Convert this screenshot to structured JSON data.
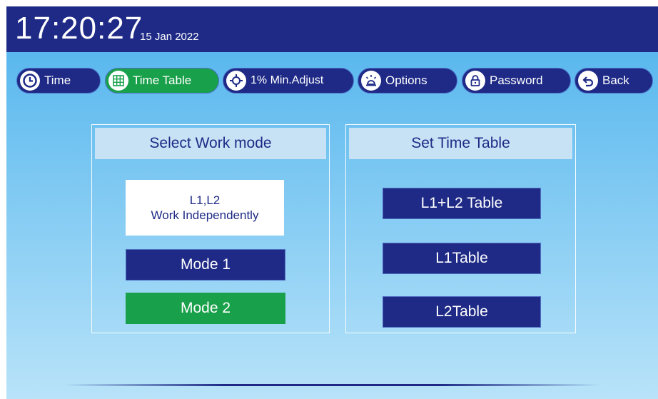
{
  "header": {
    "time": "17:20:27",
    "date": "15 Jan 2022"
  },
  "nav": [
    {
      "label": "Time",
      "icon": "clock-icon",
      "active": false
    },
    {
      "label": "Time Table",
      "icon": "grid-icon",
      "active": true
    },
    {
      "label": "1% Min.Adjust",
      "icon": "crosshair-icon",
      "active": false
    },
    {
      "label": "Options",
      "icon": "beacon-icon",
      "active": false
    },
    {
      "label": "Password",
      "icon": "lock-icon",
      "active": false
    },
    {
      "label": "Back",
      "icon": "back-arrow-icon",
      "active": false
    }
  ],
  "work_mode": {
    "title": "Select Work mode",
    "info_line1": "L1,L2",
    "info_line2": "Work Independently",
    "mode1": "Mode 1",
    "mode2": "Mode 2",
    "selected": "Mode 2"
  },
  "time_table": {
    "title": "Set Time Table",
    "l1l2": "L1+L2 Table",
    "l1": "L1Table",
    "l2": "L2Table"
  },
  "colors": {
    "navy": "#1e2a86",
    "green": "#19a04a",
    "sky": "#b8e3f9"
  }
}
